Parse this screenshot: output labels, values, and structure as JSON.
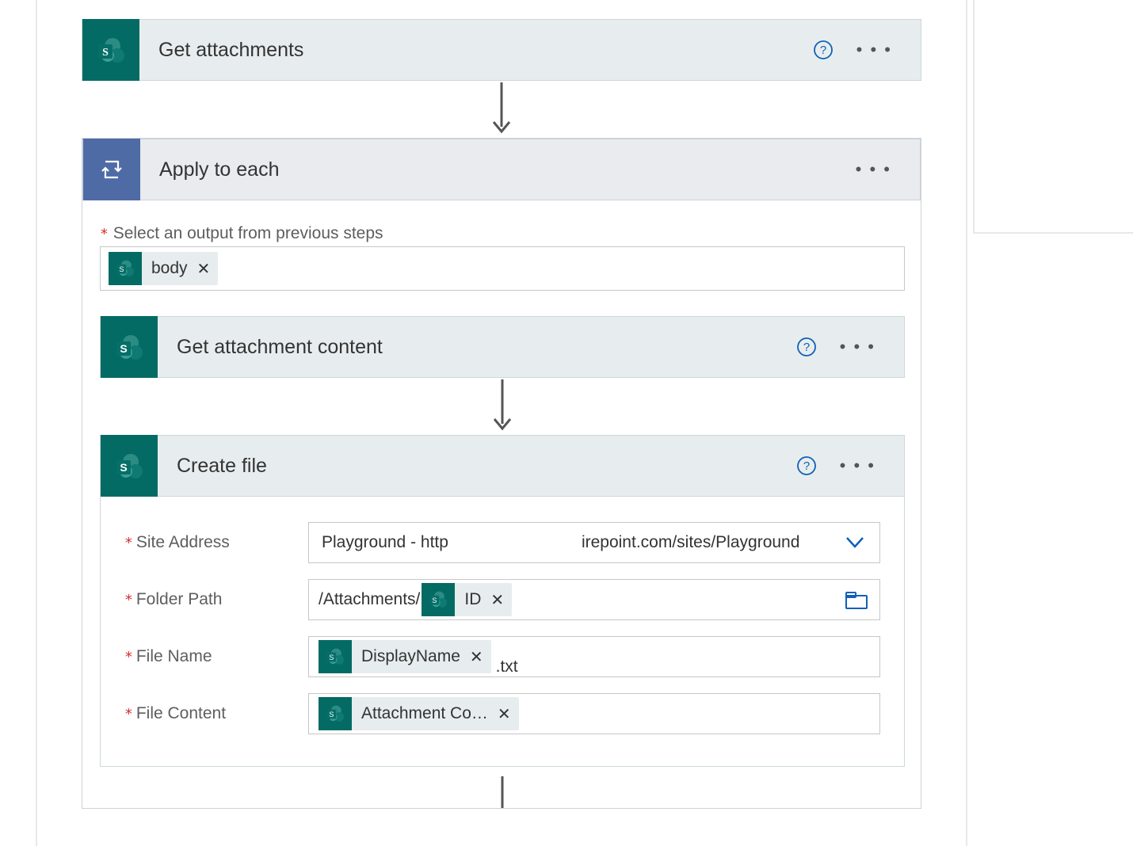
{
  "steps": {
    "get_attachments": {
      "title": "Get attachments"
    },
    "apply_to_each": {
      "title": "Apply to each",
      "output_label": "Select an output from previous steps",
      "output_token": "body"
    },
    "get_attachment_content": {
      "title": "Get attachment content"
    },
    "create_file": {
      "title": "Create file",
      "fields": {
        "site_address": {
          "label": "Site Address",
          "value_left": "Playground - http",
          "value_right": "irepoint.com/sites/Playground"
        },
        "folder_path": {
          "label": "Folder Path",
          "prefix": "/Attachments/",
          "token": "ID"
        },
        "file_name": {
          "label": "File Name",
          "token": "DisplayName",
          "suffix": ".txt"
        },
        "file_content": {
          "label": "File Content",
          "token": "Attachment Co…"
        }
      }
    }
  }
}
